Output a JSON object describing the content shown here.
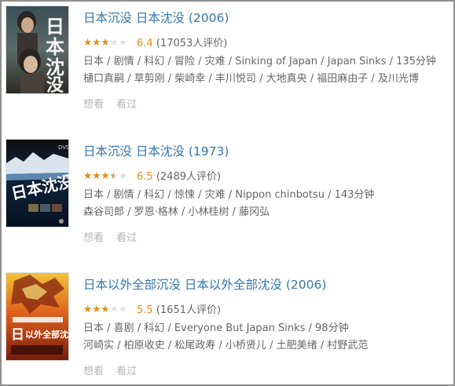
{
  "entries": [
    {
      "poster": "poster-1",
      "title": "日本沉没 日本沈没 (2006)",
      "stars": "★★★★★",
      "rating_value": 3.2,
      "rating_max": 5,
      "score": "6.4",
      "votes": "(17053人评价)",
      "meta_line1": "日本 / 剧情 / 科幻 / 冒险 / 灾难 / Sinking of Japan / Japan Sinks / 135分钟",
      "meta_line2": "樋口真嗣 / 草剪刚 / 柴崎幸 / 丰川悦司 / 大地真央 / 福田麻由子 / 及川光博",
      "want": "想看",
      "seen": "看过"
    },
    {
      "poster": "poster-2",
      "title": "日本沉没 日本沈没 (1973)",
      "stars": "★★★★★",
      "rating_value": 3.5,
      "rating_max": 5,
      "score": "6.5",
      "votes": "(2489人评价)",
      "meta_line1": "日本 / 剧情 / 科幻 / 惊悚 / 灾难 / Nippon chinbotsu / 143分钟",
      "meta_line2": "森谷司郎 / 罗恩·格林 / 小林桂树 / 藤冈弘",
      "want": "想看",
      "seen": "看过"
    },
    {
      "poster": "poster-3",
      "title": "日本以外全部沉没 日本以外全部沈没 (2006)",
      "stars": "★★★★★",
      "rating_value": 2.8,
      "rating_max": 5,
      "score": "5.5",
      "votes": "(1651人评价)",
      "meta_line1": "日本 / 喜剧 / 科幻 / Everyone But Japan Sinks / 98分钟",
      "meta_line2": "河崎实 / 柏原收史 / 松尾政寿 / 小桥贤儿 / 土肥美绪 / 村野武范",
      "want": "想看",
      "seen": "看过"
    }
  ],
  "colors": {
    "title": "#3377aa",
    "star": "#e09015",
    "meta": "#666666",
    "action": "#b5b5b5"
  }
}
